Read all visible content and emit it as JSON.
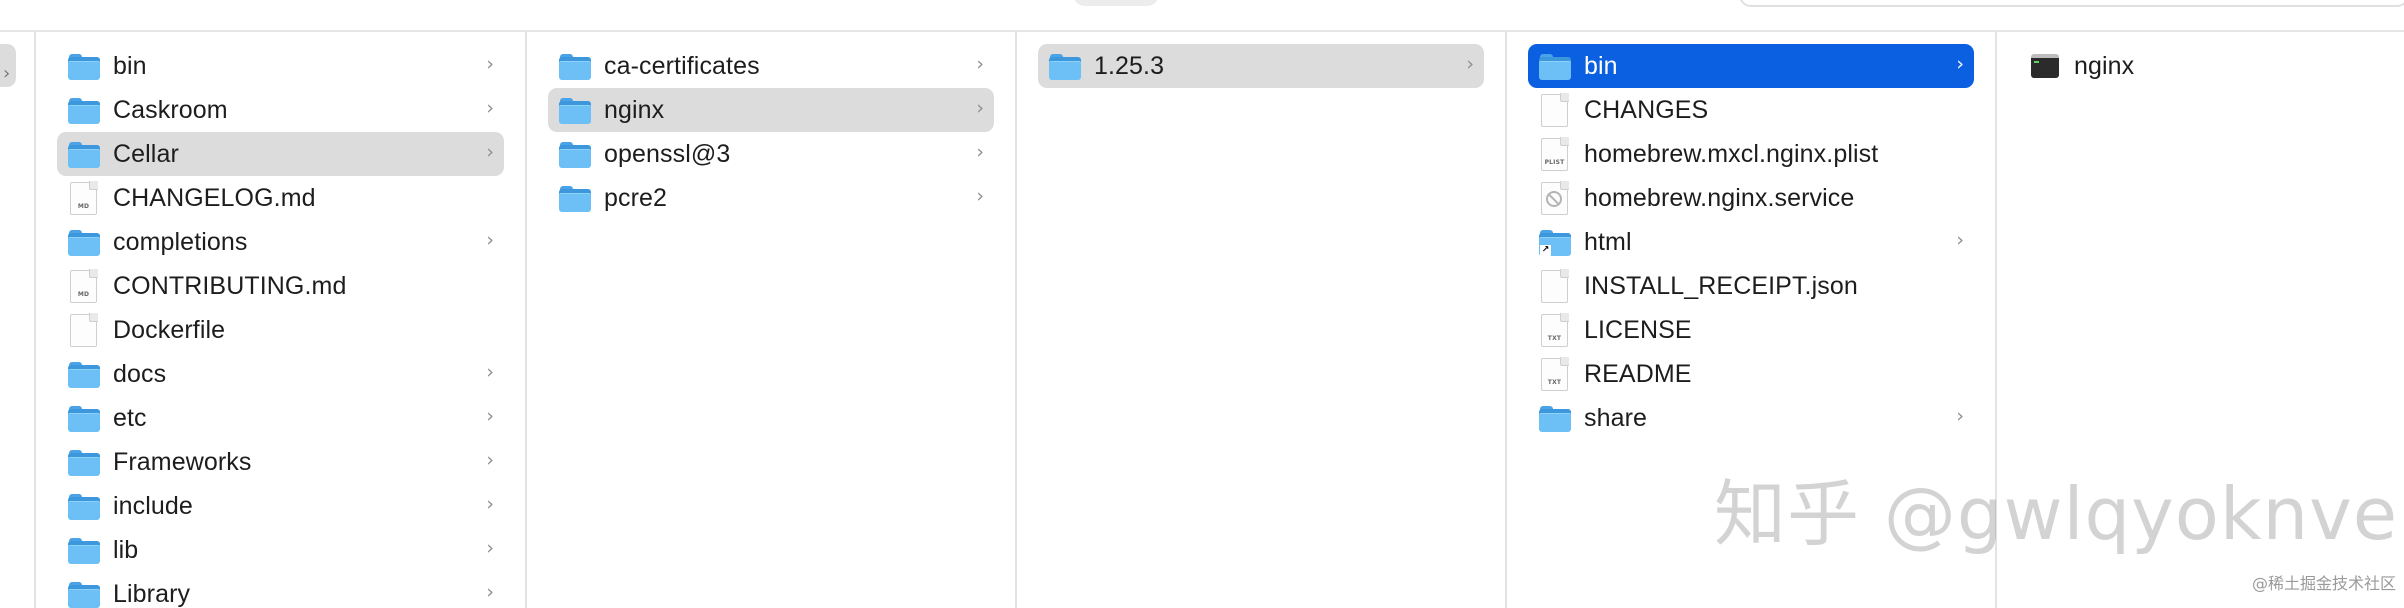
{
  "columns": [
    {
      "items": [
        {
          "label": "bin",
          "icon": "folder-icon",
          "chevron": true,
          "selected": false
        },
        {
          "label": "Caskroom",
          "icon": "folder-icon",
          "chevron": true,
          "selected": false
        },
        {
          "label": "Cellar",
          "icon": "folder-icon",
          "chevron": true,
          "selected": true
        },
        {
          "label": "CHANGELOG.md",
          "icon": "markdown-file-icon",
          "tag": "MD",
          "chevron": false,
          "selected": false
        },
        {
          "label": "completions",
          "icon": "folder-icon",
          "chevron": true,
          "selected": false
        },
        {
          "label": "CONTRIBUTING.md",
          "icon": "markdown-file-icon",
          "tag": "MD",
          "chevron": false,
          "selected": false
        },
        {
          "label": "Dockerfile",
          "icon": "file-icon",
          "chevron": false,
          "selected": false
        },
        {
          "label": "docs",
          "icon": "folder-icon",
          "chevron": true,
          "selected": false
        },
        {
          "label": "etc",
          "icon": "folder-icon",
          "chevron": true,
          "selected": false
        },
        {
          "label": "Frameworks",
          "icon": "folder-icon",
          "chevron": true,
          "selected": false
        },
        {
          "label": "include",
          "icon": "folder-icon",
          "chevron": true,
          "selected": false
        },
        {
          "label": "lib",
          "icon": "folder-icon",
          "chevron": true,
          "selected": false
        },
        {
          "label": "Library",
          "icon": "folder-icon",
          "chevron": true,
          "selected": false
        }
      ]
    },
    {
      "items": [
        {
          "label": "ca-certificates",
          "icon": "folder-icon",
          "chevron": true,
          "selected": false
        },
        {
          "label": "nginx",
          "icon": "folder-icon",
          "chevron": true,
          "selected": true
        },
        {
          "label": "openssl@3",
          "icon": "folder-icon",
          "chevron": true,
          "selected": false
        },
        {
          "label": "pcre2",
          "icon": "folder-icon",
          "chevron": true,
          "selected": false
        }
      ]
    },
    {
      "items": [
        {
          "label": "1.25.3",
          "icon": "folder-icon",
          "chevron": true,
          "selected": true
        }
      ]
    },
    {
      "items": [
        {
          "label": "bin",
          "icon": "folder-icon",
          "chevron": true,
          "selected": true,
          "active": true
        },
        {
          "label": "CHANGES",
          "icon": "file-icon",
          "chevron": false,
          "selected": false
        },
        {
          "label": "homebrew.mxcl.nginx.plist",
          "icon": "plist-file-icon",
          "tag": "PLIST",
          "chevron": false,
          "selected": false
        },
        {
          "label": "homebrew.nginx.service",
          "icon": "blocked-file-icon",
          "chevron": false,
          "selected": false
        },
        {
          "label": "html",
          "icon": "folder-alias-icon",
          "chevron": true,
          "selected": false
        },
        {
          "label": "INSTALL_RECEIPT.json",
          "icon": "file-icon",
          "chevron": false,
          "selected": false
        },
        {
          "label": "LICENSE",
          "icon": "text-file-icon",
          "tag": "TXT",
          "chevron": false,
          "selected": false
        },
        {
          "label": "README",
          "icon": "text-file-icon",
          "tag": "TXT",
          "chevron": false,
          "selected": false
        },
        {
          "label": "share",
          "icon": "folder-icon",
          "chevron": true,
          "selected": false
        }
      ]
    },
    {
      "items": [
        {
          "label": "nginx",
          "icon": "terminal-executable-icon",
          "chevron": false,
          "selected": false
        }
      ]
    }
  ],
  "chevron_glyph": "›",
  "alias_glyph": "↗",
  "stub_chevron_glyph": "›",
  "watermark": "知乎 @gwlqyoknve",
  "credit": "@稀土掘金技术社区",
  "colors": {
    "selection_gray": "#dcdcdc",
    "selection_blue": "#0a60e0",
    "folder_blue": "#6cc0f5"
  }
}
